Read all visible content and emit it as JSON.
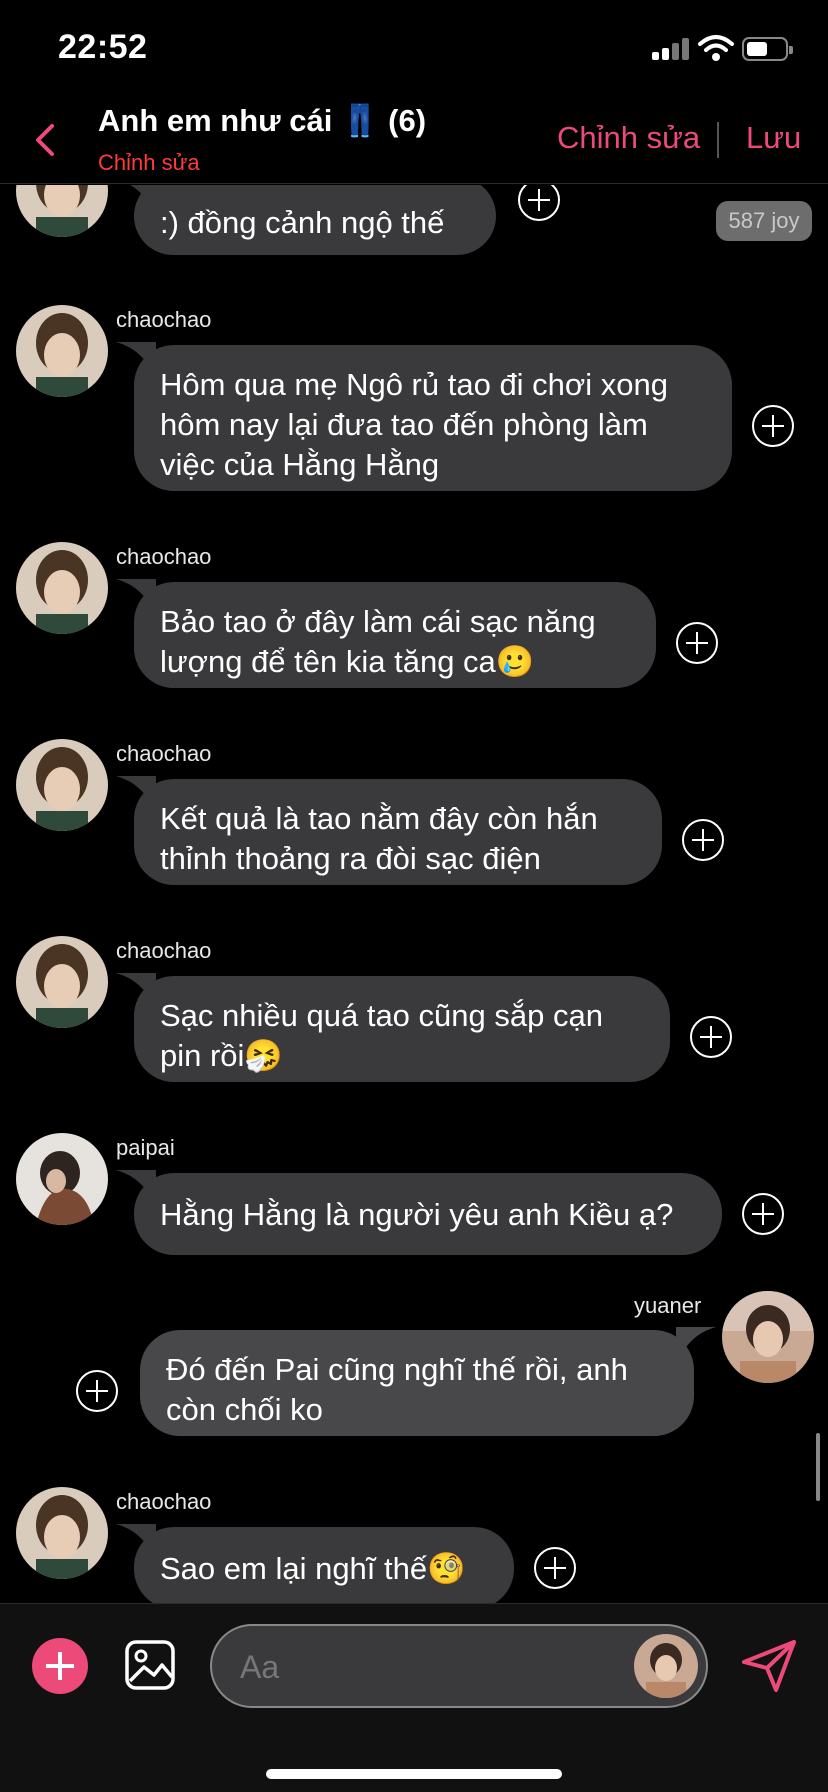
{
  "status_bar": {
    "time": "22:52"
  },
  "header": {
    "title": "Anh em như cái 👖 (6)",
    "subtitle": "Chỉnh sửa",
    "edit_label": "Chỉnh sửa",
    "save_label": "Lưu"
  },
  "joy_badge": "587 joy",
  "messages": [
    {
      "sender": "",
      "text": ":) đồng cảnh ngộ thế"
    },
    {
      "sender": "chaochao",
      "text": "Hôm qua mẹ Ngô rủ tao đi chơi xong hôm nay lại đưa tao đến phòng làm việc của Hằng Hằng"
    },
    {
      "sender": "chaochao",
      "text": "Bảo tao ở đây làm cái sạc năng lượng để tên kia tăng ca🥲"
    },
    {
      "sender": "chaochao",
      "text": "Kết quả là tao nằm đây còn hắn thỉnh thoảng ra đòi sạc điện"
    },
    {
      "sender": "chaochao",
      "text": "Sạc nhiều quá tao cũng sắp cạn pin rồi🤧"
    },
    {
      "sender": "paipai",
      "text": "Hằng Hằng là người yêu anh Kiều ạ?"
    },
    {
      "sender": "yuaner",
      "text": "Đó đến Pai cũng nghĩ thế rồi, anh còn chối ko"
    },
    {
      "sender": "chaochao",
      "text": "Sao em lại nghĩ thế🧐"
    }
  ],
  "composer": {
    "placeholder": "Aa"
  },
  "colors": {
    "accent": "#ec4a79",
    "subtitle": "#ff3b3b",
    "bubble": "#3a3a3c",
    "background": "#000000"
  }
}
